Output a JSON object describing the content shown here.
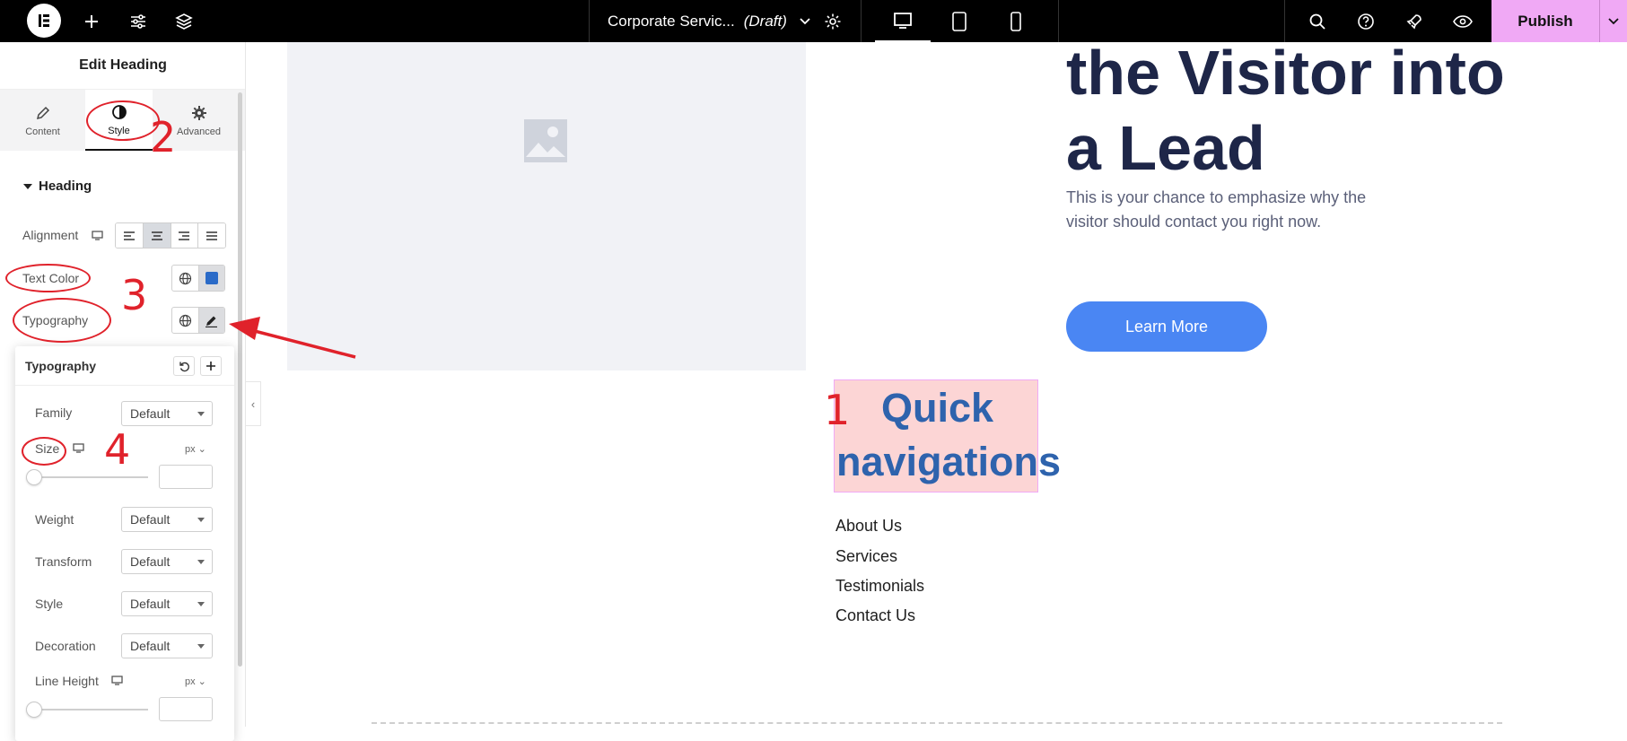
{
  "topbar": {
    "doc_title": "Corporate Servic...",
    "doc_status": "(Draft)",
    "publish_label": "Publish"
  },
  "panel": {
    "title": "Edit Heading",
    "tabs": [
      {
        "label": "Content"
      },
      {
        "label": "Style"
      },
      {
        "label": "Advanced"
      }
    ],
    "section": "Heading",
    "controls": {
      "alignment": "Alignment",
      "text_color": "Text Color",
      "typography": "Typography"
    },
    "text_color_value": "#2b6bc8"
  },
  "typography_popover": {
    "title": "Typography",
    "family_label": "Family",
    "family_value": "Default",
    "size_label": "Size",
    "size_unit": "px",
    "weight_label": "Weight",
    "weight_value": "Default",
    "transform_label": "Transform",
    "transform_value": "Default",
    "style_label": "Style",
    "style_value": "Default",
    "decoration_label": "Decoration",
    "decoration_value": "Default",
    "line_height_label": "Line Height",
    "line_height_unit": "px"
  },
  "canvas": {
    "hero_heading_line1": "the Visitor into",
    "hero_heading_line2": "a Lead",
    "hero_text": "This is your chance to emphasize why the visitor should contact you right now.",
    "cta_label": "Learn More",
    "selected_heading_line1": "Quick",
    "selected_heading_line2": "navigations",
    "nav_links": [
      "About Us",
      "Services",
      "Testimonials",
      "Contact Us"
    ]
  },
  "annotations": [
    "1",
    "2",
    "3",
    "4"
  ],
  "colors": {
    "accent": "#f0a9f5",
    "cta": "#4a86f3",
    "heading_selected": "#2e63ad",
    "hero_heading": "#1e2648",
    "annotation_red": "#e0222b"
  }
}
